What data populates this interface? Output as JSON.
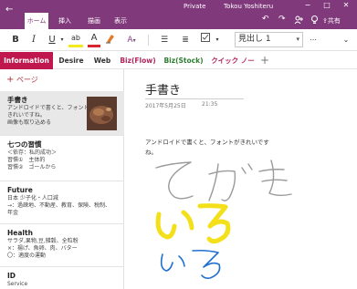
{
  "app": {
    "window_title": "Private",
    "user_name": "Tokou Yoshiteru",
    "back_glyph": "←",
    "window_buttons": [
      "−",
      "□",
      "✕"
    ]
  },
  "ribbon": {
    "tabs": [
      {
        "label": "ホーム",
        "active": true
      },
      {
        "label": "挿入",
        "active": false
      },
      {
        "label": "描画",
        "active": false
      },
      {
        "label": "表示",
        "active": false
      }
    ],
    "share_label": "共有"
  },
  "toolbar": {
    "bold": "B",
    "italic": "I",
    "underline": "U",
    "highlight": "ab",
    "font_color": "A",
    "style_value": "見出し 1"
  },
  "sections": [
    {
      "label": "Information",
      "color": "#c0174e",
      "active": true
    },
    {
      "label": "Desire",
      "color": "#333333",
      "active": false
    },
    {
      "label": "Web",
      "color": "#333333",
      "active": false
    },
    {
      "label": "Biz(Flow)",
      "color": "#b0265e",
      "active": false
    },
    {
      "label": "Biz(Stock)",
      "color": "#2e7d32",
      "active": false
    },
    {
      "label": "クイック ノート",
      "color": "#b0265e",
      "active": false
    }
  ],
  "add_section": "+",
  "add_page": {
    "plus": "+",
    "label": "ページ"
  },
  "pages": [
    {
      "title": "手書き",
      "lines": [
        "アンドロイドで書くと、フォントが",
        "きれいですね。",
        "画像も取り込める"
      ]
    },
    {
      "title": "七つの習慣",
      "lines": [
        "＜依存：私的成功＞",
        "習慣①　主体的",
        "習慣②　ゴールから"
      ]
    },
    {
      "title": "Future",
      "lines": [
        "日本 少子化・人口減",
        "→：過疎地、不動産、教育、保険、税制、",
        "年金"
      ]
    },
    {
      "title": "Health",
      "lines": [
        "サラダ,果物,豆,雑穀、全粒粉",
        "×：揚げ、魚卵、肉、バター",
        "〇：適度の運動"
      ]
    },
    {
      "title": "ID",
      "lines": [
        "Service"
      ]
    }
  ],
  "note": {
    "title": "手書き",
    "date": "2017年5月25日",
    "time": "21:35",
    "body": "アンドロイドで書くと、フォントがきれいですね。",
    "ink_colors": {
      "gray": "#9a9a9a",
      "yellow": "#f3e01a",
      "blue": "#1f6fd1"
    }
  }
}
